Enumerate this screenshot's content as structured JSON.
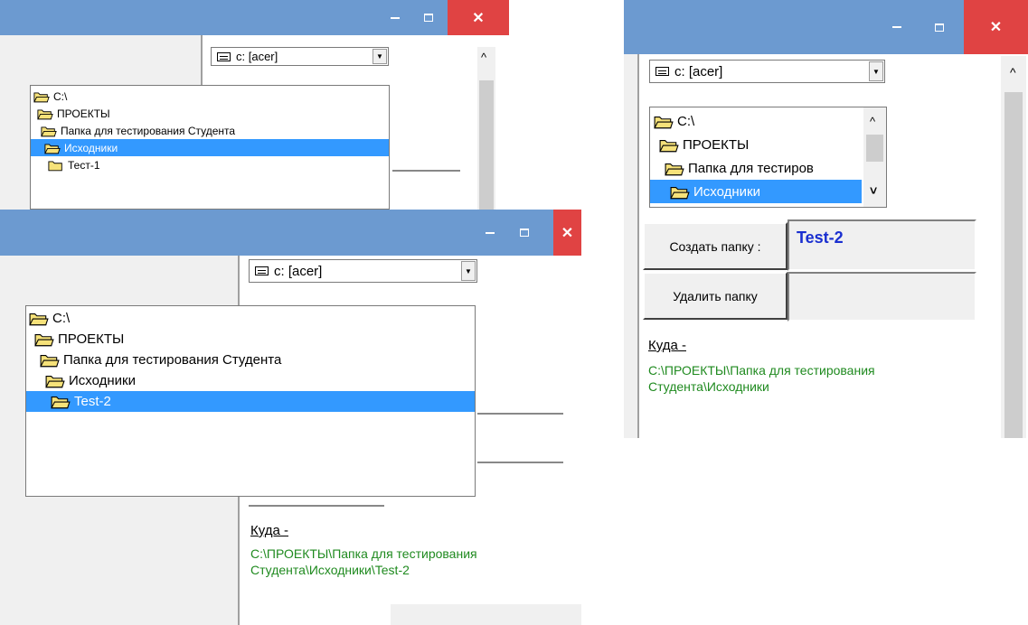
{
  "common": {
    "drive_label": "c: [acer]",
    "combo_arrow": "▼",
    "scroll_up": "^",
    "minimize_glyph": "",
    "close_glyph": "✕",
    "kuda_label": "Куда -"
  },
  "colors": {
    "titlebar": "#6c9ad0",
    "selection": "#3399ff",
    "path_text": "#1f8a1f",
    "folder_name": "#1a2fd0",
    "close": "#e04343"
  },
  "panel_a": {
    "tree": [
      {
        "label": "C:\\",
        "selected": false
      },
      {
        "label": "ПРОЕКТЫ",
        "selected": false
      },
      {
        "label": "Папка для тестирования Студента",
        "selected": false
      },
      {
        "label": "Исходники",
        "selected": true
      },
      {
        "label": "Тест-1",
        "selected": false
      }
    ]
  },
  "panel_b": {
    "tree": [
      {
        "label": "C:\\",
        "selected": false
      },
      {
        "label": "ПРОЕКТЫ",
        "selected": false
      },
      {
        "label": "Папка для тестирования Студента",
        "selected": false
      },
      {
        "label": "Исходники",
        "selected": false
      },
      {
        "label": "Test-2",
        "selected": true
      }
    ],
    "path_line1": "C:\\ПРОЕКТЫ\\Папка для тестирования",
    "path_line2": "Студента\\Исходники\\Test-2"
  },
  "panel_c": {
    "tree": [
      {
        "label": "C:\\",
        "selected": false
      },
      {
        "label": "ПРОЕКТЫ",
        "selected": false
      },
      {
        "label": "Папка для тестиров",
        "selected": false
      },
      {
        "label": "Исходники",
        "selected": true
      }
    ],
    "create_button": "Создать папку :",
    "delete_button": "Удалить папку",
    "folder_name_value": "Test-2",
    "path_line1": "C:\\ПРОЕКТЫ\\Папка для тестирования",
    "path_line2": "Студента\\Исходники",
    "tree_scroll_down": "˅"
  }
}
